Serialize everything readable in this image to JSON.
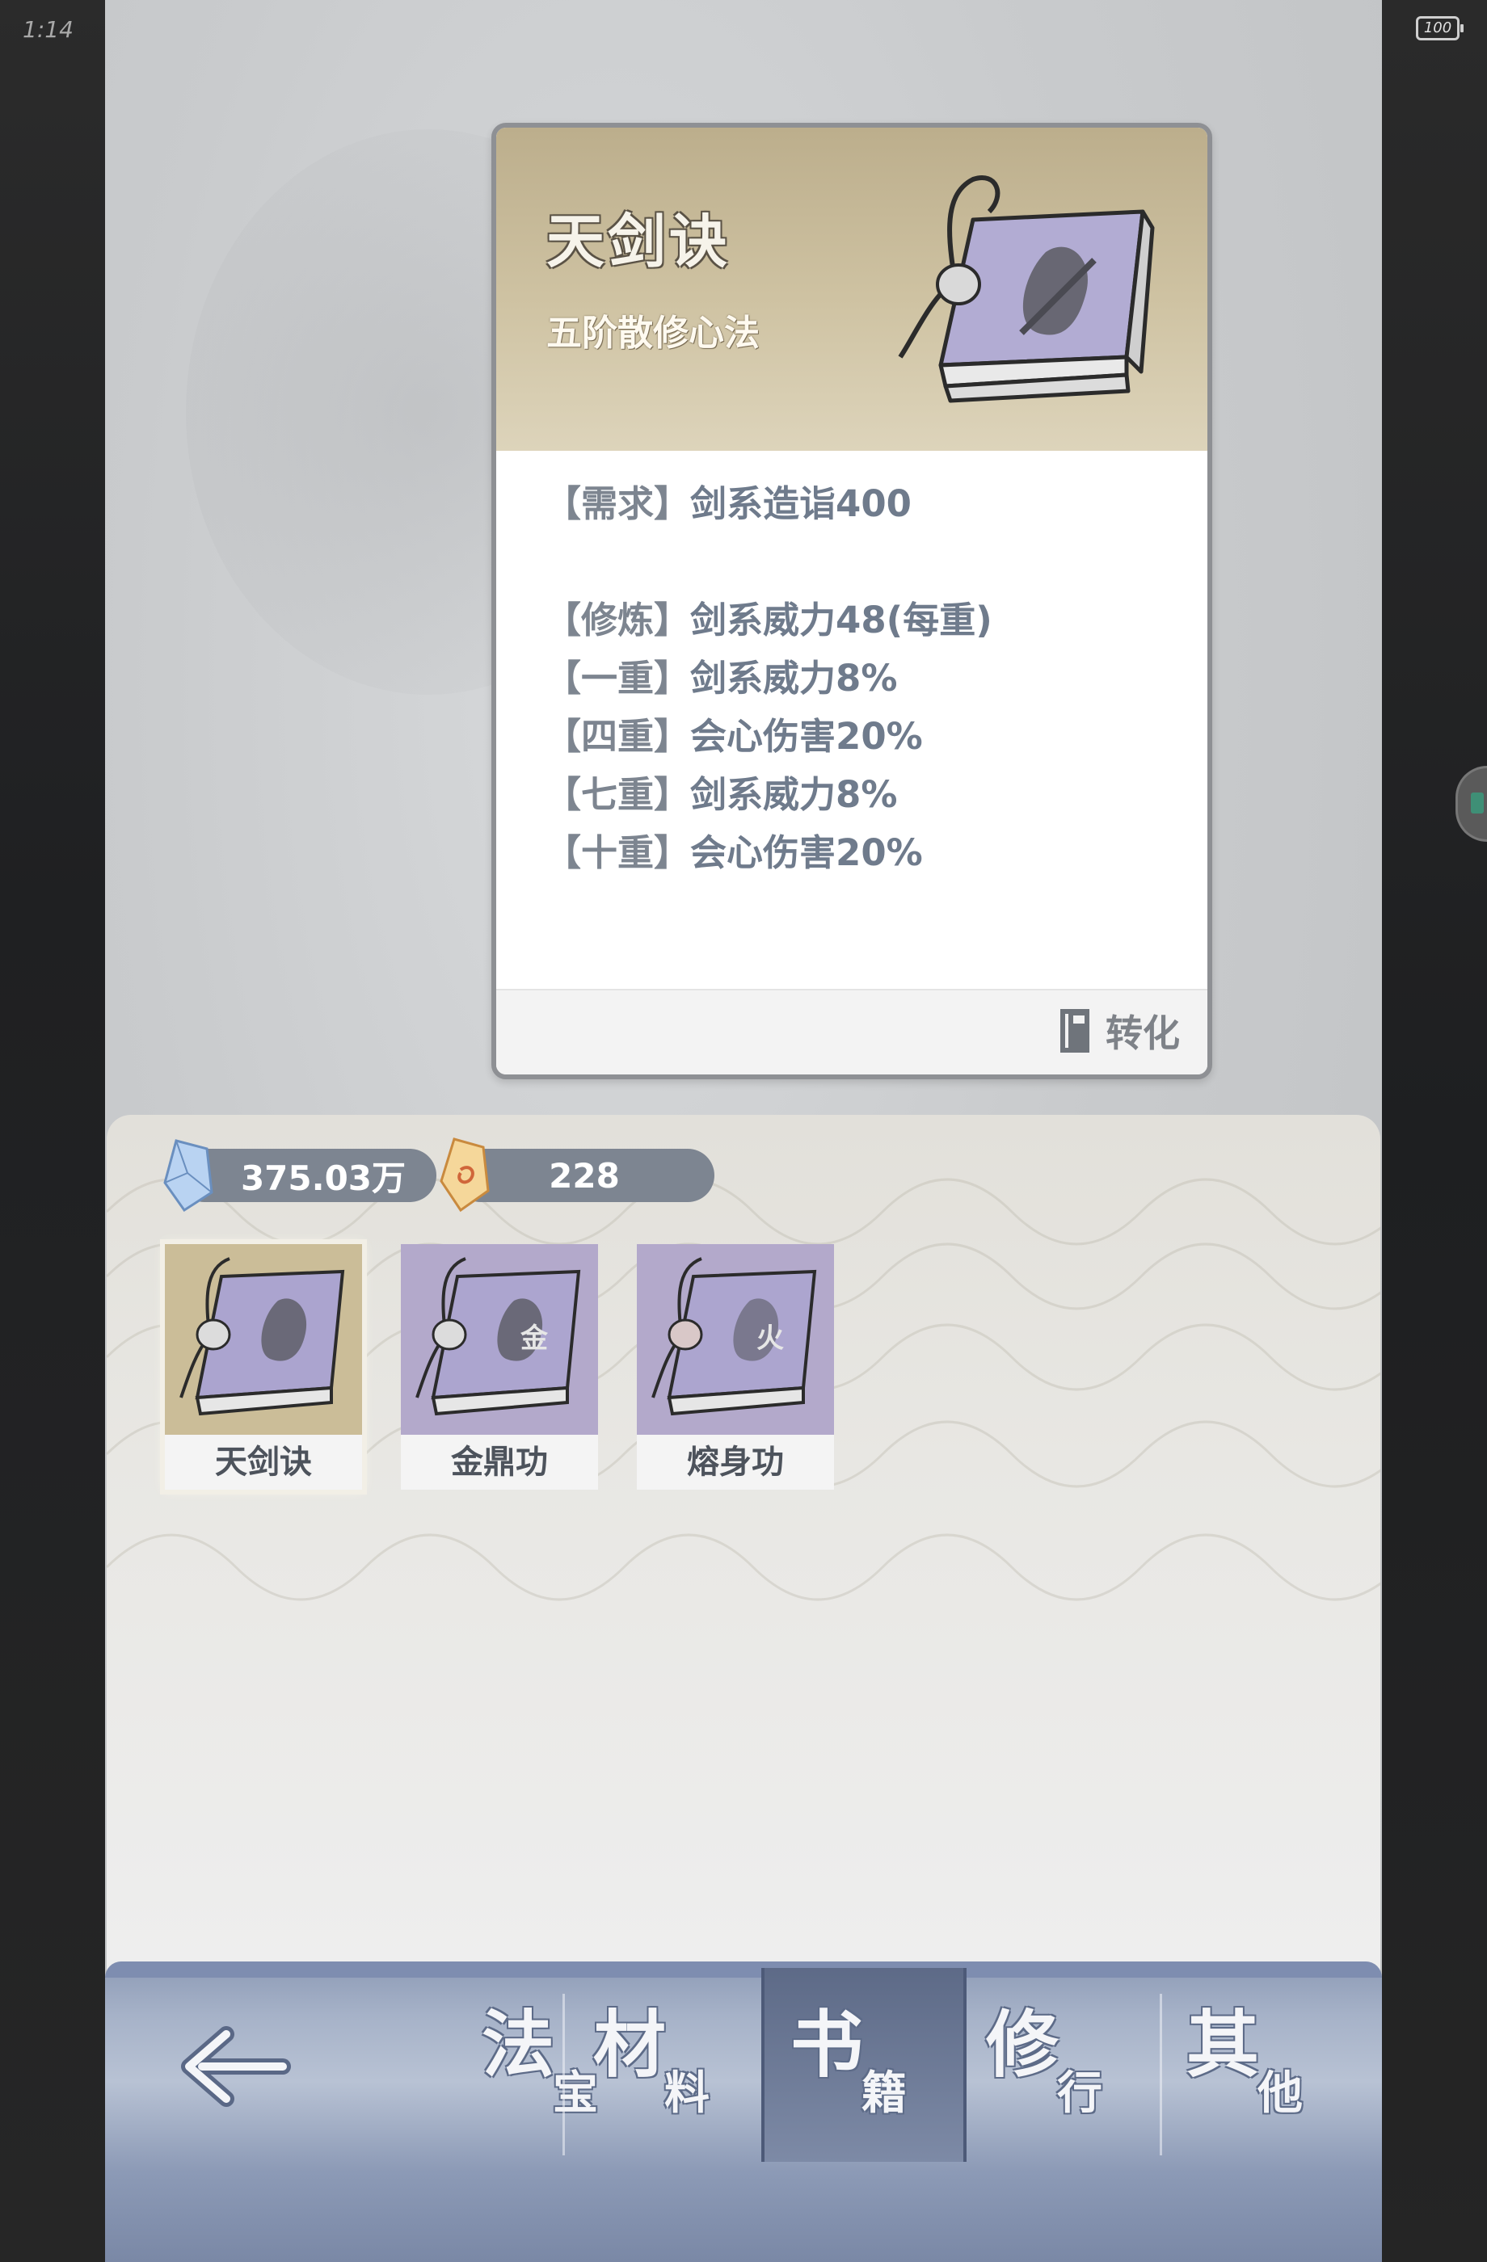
{
  "status": {
    "time": "1:14",
    "battery": "100"
  },
  "detail": {
    "title": "天剑诀",
    "subtitle": "五阶散修心法",
    "requirement": {
      "key": "【需求】",
      "value": "剑系造诣400"
    },
    "effects": [
      {
        "key": "【修炼】",
        "value": "剑系威力48(每重)"
      },
      {
        "key": "【一重】",
        "value": "剑系威力8%"
      },
      {
        "key": "【四重】",
        "value": "会心伤害20%"
      },
      {
        "key": "【七重】",
        "value": "剑系威力8%"
      },
      {
        "key": "【十重】",
        "value": "会心伤害20%"
      }
    ],
    "convert_label": "转化"
  },
  "resources": [
    {
      "icon": "blue-spirit-stone-icon",
      "value": "375.03万"
    },
    {
      "icon": "gold-spirit-stone-icon",
      "value": "228"
    }
  ],
  "items": [
    {
      "name": "天剑诀",
      "selected": true,
      "emblem": "sword-figure"
    },
    {
      "name": "金鼎功",
      "selected": false,
      "emblem": "金"
    },
    {
      "name": "熔身功",
      "selected": false,
      "emblem": "火"
    }
  ],
  "nav": {
    "back_icon": "back-arrow-icon",
    "tabs": [
      {
        "big": "法",
        "small": "宝",
        "active": false
      },
      {
        "big": "材",
        "small": "料",
        "active": false
      },
      {
        "big": "书",
        "small": "籍",
        "active": true
      },
      {
        "big": "修",
        "small": "行",
        "active": false
      },
      {
        "big": "其",
        "small": "他",
        "active": false
      }
    ]
  },
  "colors": {
    "card_header": "#cfc3a3",
    "book_cover": "#a59ec7",
    "nav_active": "#5d6a87",
    "text_effect": "#7d8590"
  }
}
